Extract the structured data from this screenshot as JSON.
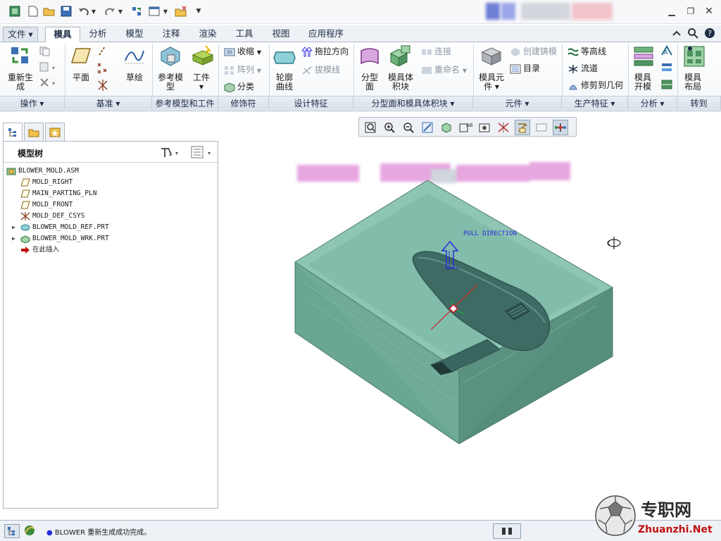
{
  "title_bar": {
    "quick_access_icons": [
      "app-icon",
      "new-icon",
      "open-icon",
      "save-icon",
      "undo-icon",
      "redo-icon",
      "regenerate-icon",
      "window-icon",
      "close-window-icon",
      "customize-icon"
    ],
    "window_controls": [
      "minimize",
      "restore",
      "close"
    ]
  },
  "tabs": {
    "file": "文件",
    "items": [
      "模具",
      "分析",
      "模型",
      "注释",
      "渲染",
      "工具",
      "视图",
      "应用程序"
    ],
    "active": "模具"
  },
  "ribbon": {
    "operations": {
      "regenerate": "重新生\n成",
      "group": "操作"
    },
    "datum": {
      "plane": "平面",
      "sketch": "草绘",
      "group": "基准"
    },
    "ref_model": {
      "ref_model": "参考模\n型",
      "workpiece": "工件",
      "group": "参考模型和工件"
    },
    "decoration": {
      "shrink": "收缩",
      "pattern": "阵列",
      "classify": "分类",
      "group": "修饰符"
    },
    "design": {
      "contour_curve": "轮廓\n曲线",
      "pull_direction": "拖拉方向",
      "draft_line": "拔模线",
      "group": "设计特征"
    },
    "parting": {
      "parting_surface": "分型\n面",
      "mold_volume": "模具体\n积块",
      "connect": "连接",
      "rename": "重命名",
      "group": "分型面和模具体积块"
    },
    "components": {
      "mold_component": "模具元\n件",
      "create_casting": "创建铸模",
      "catalog": "目录",
      "group": "元件"
    },
    "production": {
      "contour": "等高线",
      "flow": "流道",
      "trim_geometry": "修剪到几何",
      "group": "生产特征"
    },
    "analysis": {
      "mold_open": "模具\n开模",
      "group": "分析"
    },
    "goto": {
      "mold_layout": "模具\n布局",
      "group": "转到"
    }
  },
  "model_tree": {
    "title": "模型树",
    "items": [
      {
        "label": "BLOWER_MOLD.ASM",
        "icon": "assembly-icon",
        "indent": 0,
        "expand": false
      },
      {
        "label": "MOLD_RIGHT",
        "icon": "datum-plane-icon",
        "indent": 1,
        "expand": false
      },
      {
        "label": "MAIN_PARTING_PLN",
        "icon": "datum-plane-icon",
        "indent": 1,
        "expand": false
      },
      {
        "label": "MOLD_FRONT",
        "icon": "datum-plane-icon",
        "indent": 1,
        "expand": false
      },
      {
        "label": "MOLD_DEF_CSYS",
        "icon": "csys-icon",
        "indent": 1,
        "expand": false
      },
      {
        "label": "BLOWER_MOLD_REF.PRT",
        "icon": "part-icon",
        "indent": 1,
        "expand": true
      },
      {
        "label": "BLOWER_MOLD_WRK.PRT",
        "icon": "workpiece-icon",
        "indent": 1,
        "expand": true
      },
      {
        "label": "在此插入",
        "icon": "insert-arrow-icon",
        "indent": 1,
        "expand": false
      }
    ]
  },
  "graphics": {
    "pull_direction_label": "PULL DIRECTION",
    "colors": {
      "block": "#5f9b8a",
      "part": "#3e6b63",
      "arrow": "#2b2be0"
    }
  },
  "status_bar": {
    "message": "BLOWER 重新生成成功完成。"
  },
  "watermark": {
    "site_cn": "专职网",
    "site_en": "Zhuanzhi.Net"
  }
}
